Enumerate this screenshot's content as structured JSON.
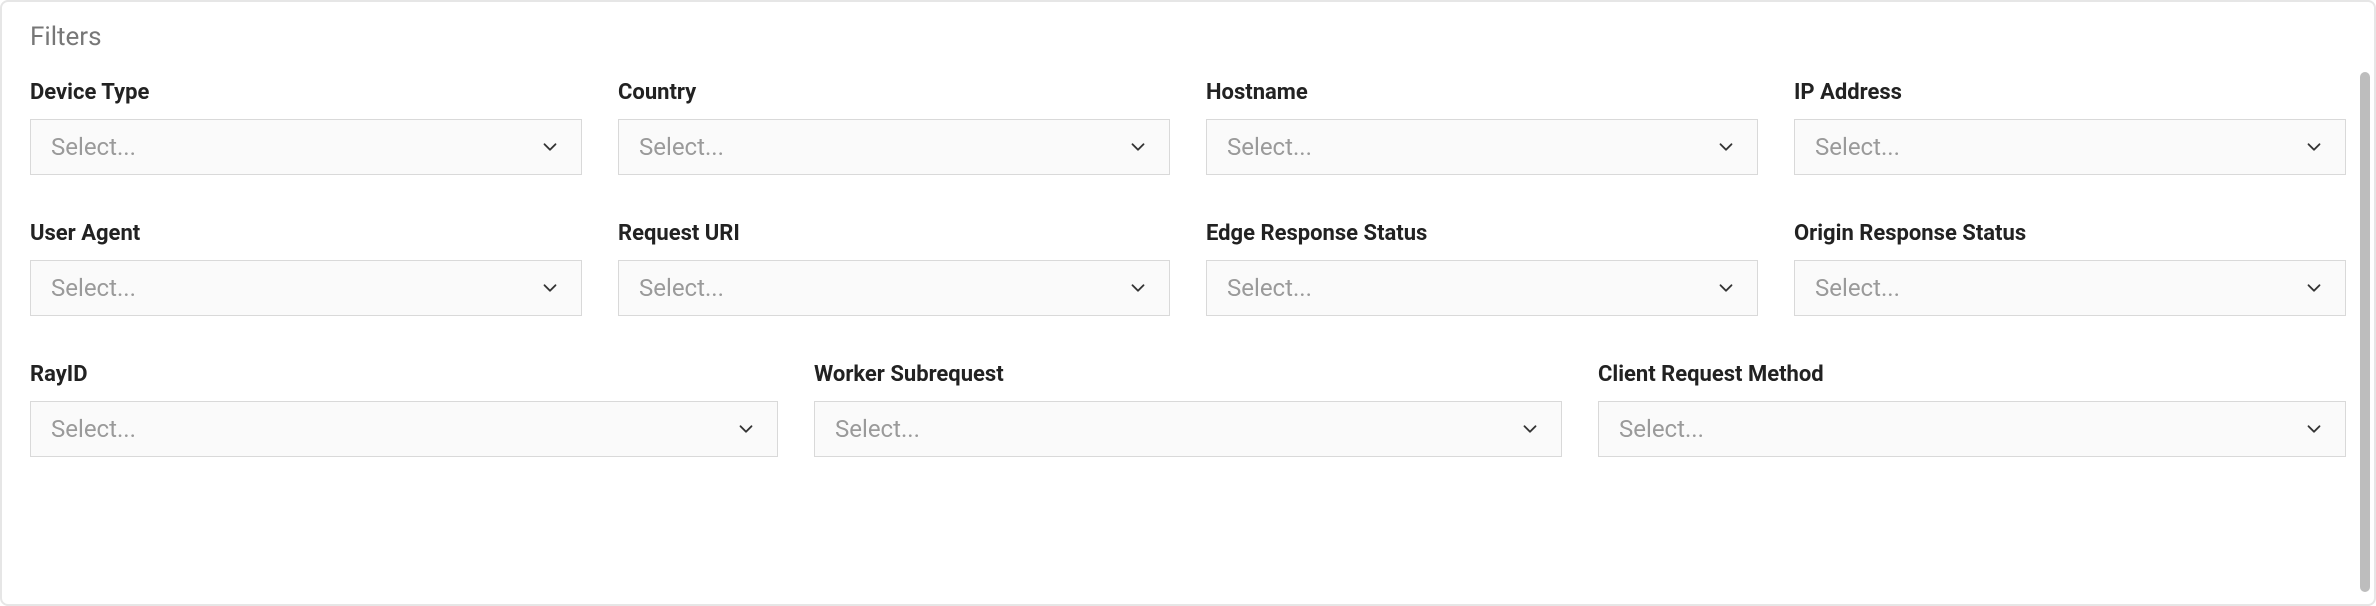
{
  "panel": {
    "title": "Filters"
  },
  "placeholders": {
    "select": "Select..."
  },
  "filters": {
    "row1": {
      "device_type": {
        "label": "Device Type"
      },
      "country": {
        "label": "Country"
      },
      "hostname": {
        "label": "Hostname"
      },
      "ip_address": {
        "label": "IP Address"
      }
    },
    "row2": {
      "user_agent": {
        "label": "User Agent"
      },
      "request_uri": {
        "label": "Request URI"
      },
      "edge_response_status": {
        "label": "Edge Response Status"
      },
      "origin_response_status": {
        "label": "Origin Response Status"
      }
    },
    "row3": {
      "ray_id": {
        "label": "RayID"
      },
      "worker_subrequest": {
        "label": "Worker Subrequest"
      },
      "client_request_method": {
        "label": "Client Request Method"
      }
    }
  }
}
